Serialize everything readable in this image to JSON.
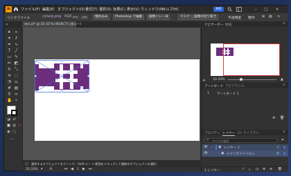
{
  "app": {
    "logo_text": "Ai",
    "share_label": "共有"
  },
  "menu": [
    "ファイル(F)",
    "編集(E)",
    "オブジェクト(O)",
    "書式(T)",
    "選択(S)",
    "効果(C)",
    "表示(V)",
    "ウィンドウ(W)",
    "ヘルプ(H)"
  ],
  "control_bar": {
    "object_type": "リンクファイル",
    "file_name": "cyharp.png",
    "color_info": "RGB",
    "ppi_info": "PPI：288",
    "embed_label": "埋め込み",
    "photoshop_edit_label": "Photoshop で編集",
    "image_trace_label": "画像トレース",
    "mask_label": "マスク",
    "crop_label": "画像の切り抜き",
    "opacity_label": "不透明度",
    "align_label": "整列"
  },
  "document_tab": {
    "title": "doc.ai* @ 33.33 % (RGB/プレビュー)",
    "close_glyph": "×"
  },
  "status": {
    "zoom": "33.33%",
    "hint": "選択するオブジェクトをクリック：Shift キー + 範囲をドラッグして複数のオブジェクトを選択：",
    "artboard_number": "1"
  },
  "panels": {
    "navigator": {
      "tab": "ナビゲーター",
      "tab2": "情報",
      "zoom": "33.33%"
    },
    "artboards": {
      "tab": "アートボード",
      "tab2": "アピアランス",
      "row_number": "1",
      "row_name": "アートボード 1"
    },
    "layers": {
      "tabs": [
        "プロパティ",
        "レイヤー",
        "CC ライブラリ"
      ],
      "search_placeholder": "すべてを検索",
      "rows": [
        {
          "name": "レイヤー 1"
        },
        {
          "name": "<リンクファイル>"
        }
      ],
      "count_label": "1 レイヤー"
    }
  },
  "colors": {
    "image_purple": "#6b2d7c",
    "selection_blue": "#4a74d9",
    "accent": "#2b64d8"
  },
  "icons": {
    "tools": [
      "selection-arrow",
      "direct-selection",
      "magic-wand",
      "lasso",
      "pen",
      "curvature",
      "type",
      "line",
      "rectangle",
      "paintbrush",
      "pencil",
      "eraser",
      "rotate",
      "scale",
      "width",
      "free-transform",
      "shape-builder",
      "perspective",
      "mesh",
      "gradient",
      "eyedropper",
      "blend",
      "symbol-sprayer",
      "column-graph",
      "artboard",
      "slice",
      "hand",
      "zoom"
    ]
  }
}
